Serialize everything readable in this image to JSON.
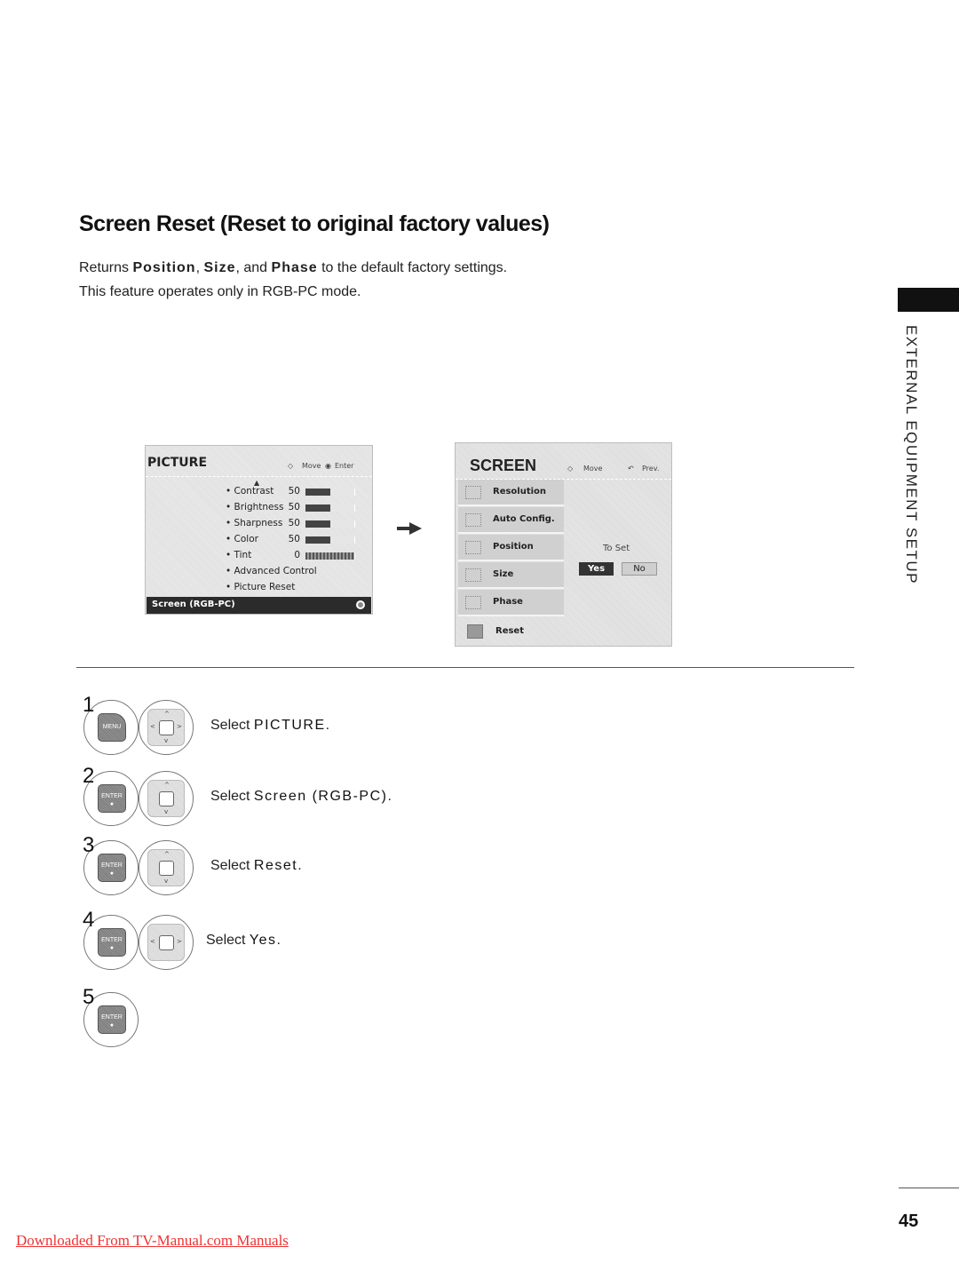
{
  "page": {
    "title": "Screen Reset (Reset to original factory values)",
    "description": {
      "line1_prefix": "Returns ",
      "term1": "Position",
      "sep1": ", ",
      "term2": "Size",
      "sep2": ", and ",
      "term3": "Phase",
      "line1_suffix": " to the default factory settings.",
      "line2": "This feature operates only in RGB-PC mode."
    },
    "side_tab_label": "EXTERNAL EQUIPMENT SETUP",
    "page_number": "45",
    "footer_link": "Downloaded From TV-Manual.com Manuals"
  },
  "picture_osd": {
    "title": "PICTURE",
    "hint_move": "Move",
    "hint_enter": "Enter",
    "items": [
      {
        "label": "• Contrast",
        "value": "50",
        "level": 0.5
      },
      {
        "label": "• Brightness",
        "value": "50",
        "level": 0.5
      },
      {
        "label": "• Sharpness",
        "value": "50",
        "level": 0.5
      },
      {
        "label": "• Color",
        "value": "50",
        "level": 0.5
      },
      {
        "label": "• Tint",
        "value": "0",
        "level": 0.5
      }
    ],
    "links": [
      "• Advanced Control",
      "• Picture Reset"
    ],
    "selected": "Screen (RGB-PC)"
  },
  "screen_osd": {
    "title": "SCREEN",
    "hint_move": "Move",
    "hint_prev": "Prev.",
    "items": [
      "Resolution",
      "Auto Config.",
      "Position",
      "Size",
      "Phase"
    ],
    "reset_label": "Reset",
    "dialog_title": "To Set",
    "yes_label": "Yes",
    "no_label": "No"
  },
  "steps": [
    {
      "num": "1",
      "prefix": "Select ",
      "term": "PICTURE",
      "suffix": ".",
      "key": "MENU"
    },
    {
      "num": "2",
      "prefix": "Select ",
      "term": "Screen (RGB-PC)",
      "suffix": ".",
      "key": "ENTER"
    },
    {
      "num": "3",
      "prefix": "Select ",
      "term": "Reset",
      "suffix": ".",
      "key": "ENTER"
    },
    {
      "num": "4",
      "prefix": "Select ",
      "term": "Yes",
      "suffix": ".",
      "key": "ENTER"
    },
    {
      "num": "5",
      "key": "ENTER"
    }
  ]
}
